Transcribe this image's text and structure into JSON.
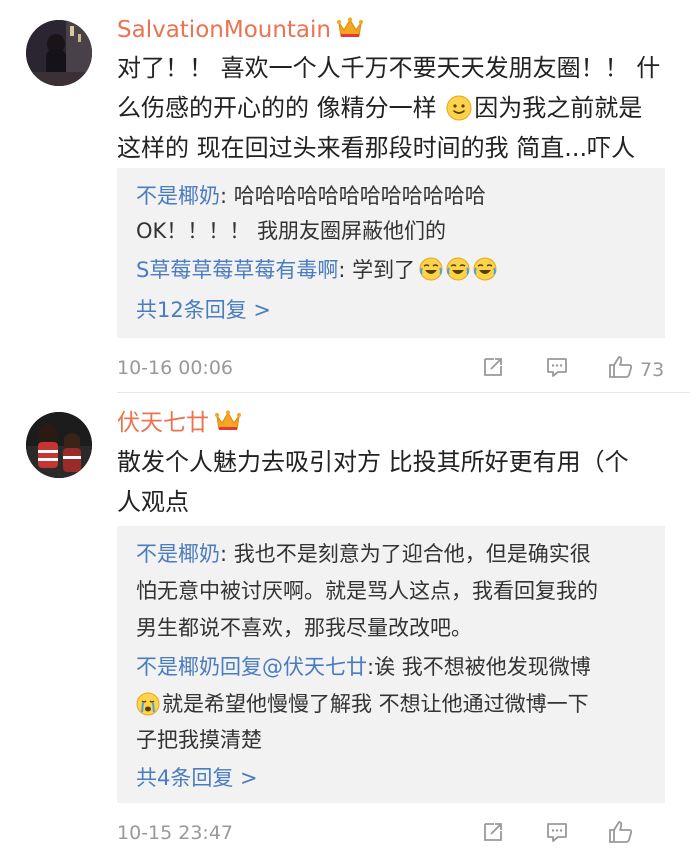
{
  "comments": [
    {
      "username": "SalvationMountain",
      "text_lines": [
        "对了！！ 喜欢一个人千万不要天天发朋友圈！！ 什",
        "么伤感的开心的的 像精分一样",
        "因为我之前就是",
        "这样的 现在回过头来看那段时间的我 简直...吓人"
      ],
      "replies": [
        {
          "name": "不是椰奶",
          "sep": ": ",
          "text": "哈哈哈哈哈哈哈哈哈哈哈哈"
        },
        {
          "name": "",
          "sep": "",
          "text": "OK！！！！ 我朋友圈屏蔽他们的"
        },
        {
          "name": "S草莓草莓草莓有毒啊",
          "sep": ": ",
          "text": "学到了"
        }
      ],
      "more_replies": "共12条回复 >",
      "time": "10-16 00:06",
      "likes": "73"
    },
    {
      "username": "伏天七廿",
      "text_lines": [
        "散发个人魅力去吸引对方 比投其所好更有用（个",
        "人观点"
      ],
      "replies": [
        {
          "name": "不是椰奶",
          "sep": ": ",
          "text": "我也不是刻意为了迎合他，但是确实很"
        },
        {
          "name": "",
          "sep": "",
          "text": "怕无意中被讨厌啊。就是骂人这点，我看回复我的"
        },
        {
          "name": "",
          "sep": "",
          "text": "男生都说不喜欢，那我尽量改改吧。"
        },
        {
          "name": "不是椰奶回复@伏天七廿",
          "sep": ":",
          "text": "诶 我不想被他发现微博"
        },
        {
          "name": "",
          "sep": "",
          "text": "就是希望他慢慢了解我 不想让他通过微博一下"
        },
        {
          "name": "",
          "sep": "",
          "text": "子把我摸清楚"
        }
      ],
      "more_replies": "共4条回复 >",
      "time": "10-15 23:47",
      "likes": ""
    }
  ],
  "icons": {
    "crown": "crown-icon",
    "share": "share-icon",
    "comment": "comment-icon",
    "like": "thumbs-up-icon",
    "smile": "smile-emoji",
    "laugh_cry": "laugh-cry-emoji",
    "sad": "sad-emoji"
  },
  "colors": {
    "username": "#eb7350",
    "reply_link": "#4a7cc0",
    "reply_bg": "#f2f2f2",
    "meta": "#999999"
  }
}
